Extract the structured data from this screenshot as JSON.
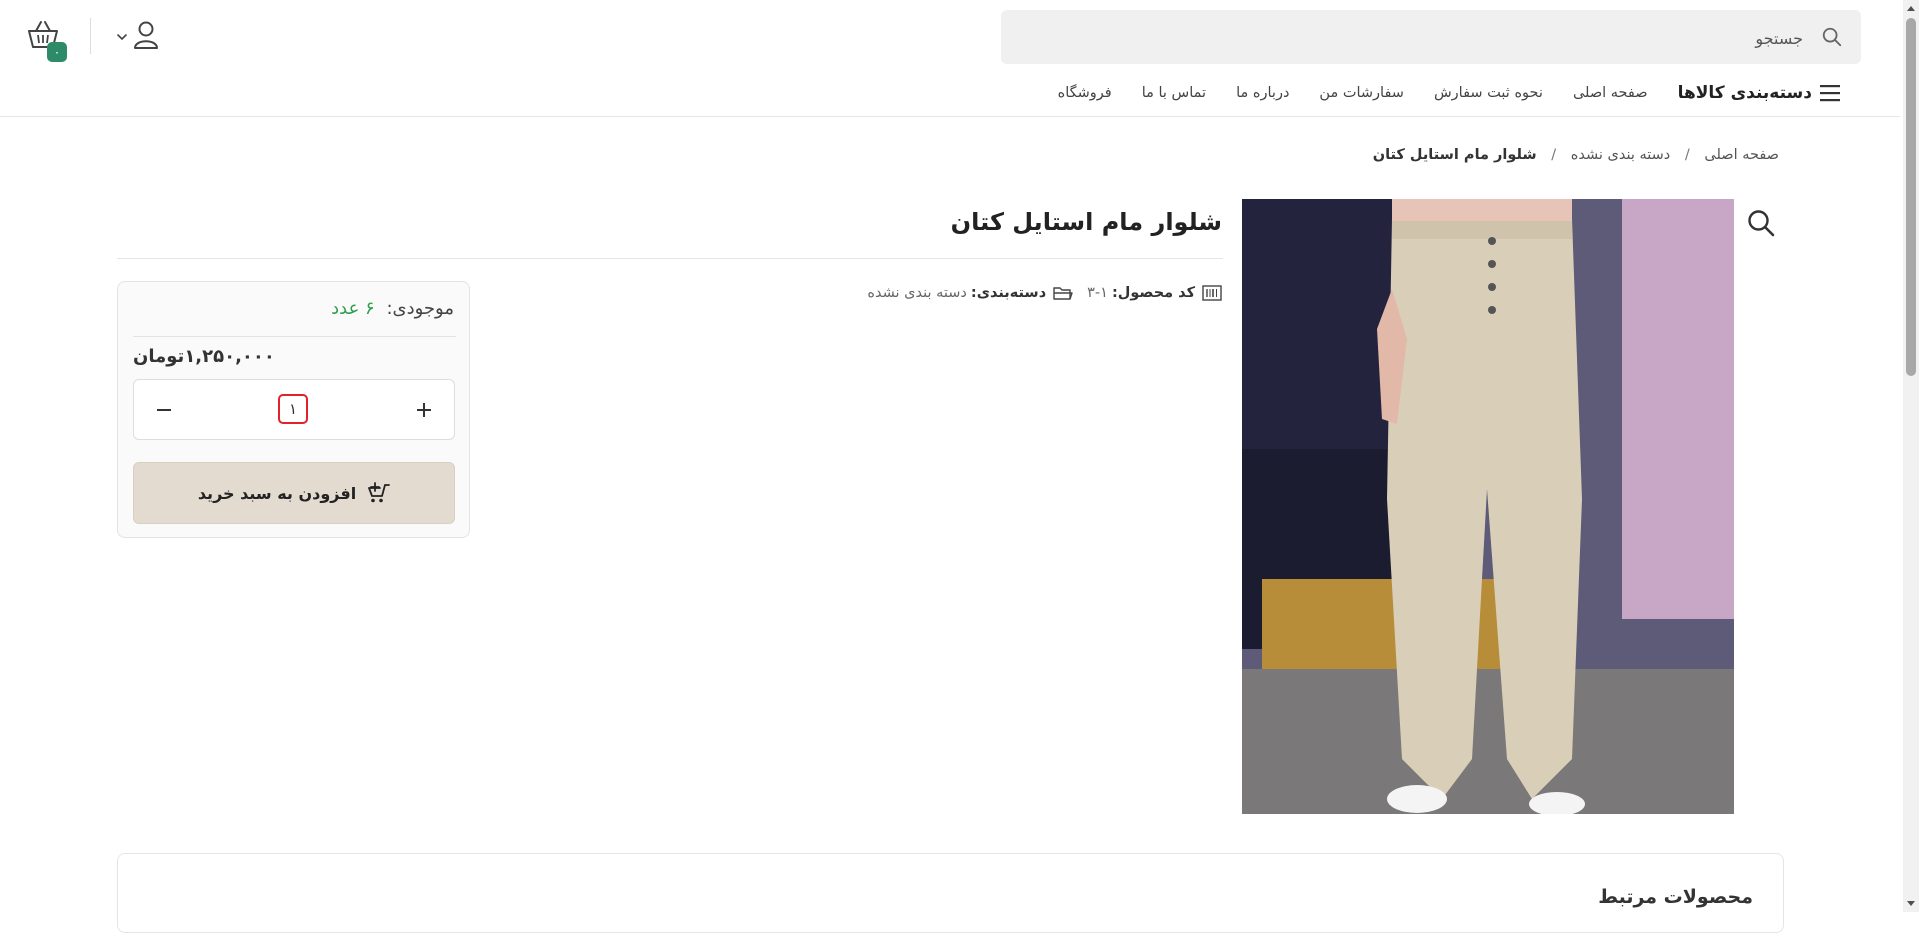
{
  "header": {
    "search_placeholder": "جستجو",
    "cart_count": "۰",
    "nav": {
      "categories_label": "دسته‌بندی کالاها",
      "links": [
        "صفحه اصلی",
        "نحوه ثبت سفارش",
        "سفارشات من",
        "درباره ما",
        "تماس با ما",
        "فروشگاه"
      ]
    }
  },
  "breadcrumb": {
    "home": "صفحه اصلی",
    "sep": "/",
    "category": "دسته بندی نشده",
    "current": "شلوار مام استایل کتان"
  },
  "product": {
    "title": "شلوار مام استایل کتان",
    "code_label": "کد محصول:",
    "code_value": "۳-۱",
    "category_label": "دسته‌بندی:",
    "category_value": "دسته بندی نشده"
  },
  "buy_box": {
    "stock_label": "موجودی:",
    "stock_value": "۶ عدد",
    "price": "۱,۲۵۰,۰۰۰تومان",
    "quantity": "۱",
    "add_to_cart_label": "افزودن به سبد خرید"
  },
  "related": {
    "title": "محصولات مرتبط"
  },
  "colors": {
    "accent_green": "#2e8b68",
    "stock_green": "#2f9e4a",
    "add_button_bg": "#e3dbd0",
    "highlight_red": "#e0222a"
  }
}
